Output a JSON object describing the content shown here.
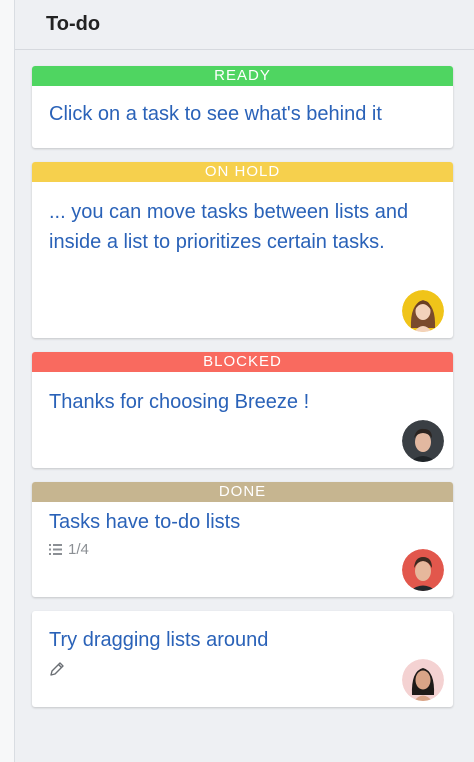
{
  "column": {
    "title": "To-do"
  },
  "cards": [
    {
      "status": "READY",
      "status_color": "#4fd561",
      "title": "Click on a task to see what's behind it"
    },
    {
      "status": "ON HOLD",
      "status_color": "#f6d04d",
      "title": "... you can move tasks between lists and inside a list to prioritizes certain tasks.",
      "avatar_icon": "avatar-woman-yellow"
    },
    {
      "status": "BLOCKED",
      "status_color": "#f96a5f",
      "title": "Thanks for choosing Breeze !",
      "avatar_icon": "avatar-man-dark"
    },
    {
      "status": "DONE",
      "status_color": "#c6b590",
      "title": "Tasks have to-do lists",
      "checklist": "1/4",
      "checklist_icon": "checklist-icon",
      "avatar_icon": "avatar-man-red"
    },
    {
      "title": "Try dragging lists around",
      "meta_icon": "pencil-icon",
      "avatar_icon": "avatar-woman-pink"
    }
  ],
  "colors": {
    "link_blue": "#2a62b8",
    "background": "#eef0f3"
  }
}
